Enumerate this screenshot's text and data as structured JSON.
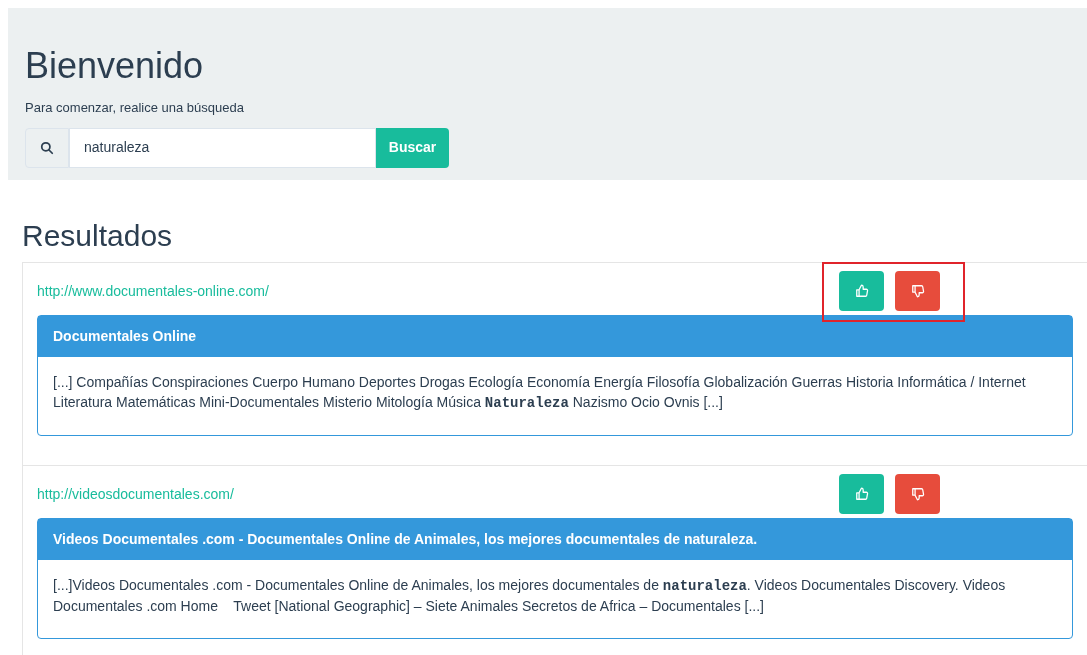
{
  "header": {
    "title": "Bienvenido",
    "subtitle": "Para comenzar, realice una búsqueda",
    "search": {
      "value": "naturaleza"
    },
    "search_button": "Buscar"
  },
  "results_title": "Resultados",
  "results": [
    {
      "url": "http://www.documentales-online.com/",
      "title": "Documentales Online",
      "snippet": "[...] Compañías Conspiraciones Cuerpo Humano Deportes Drogas Ecología Economía Energía Filosofía Globalización Guerras Historia Informática / Internet Literatura Matemáticas Mini-Documentales Misterio Mitología Música **Naturaleza** Nazismo Ocio Ovnis [...]",
      "highlighted": true
    },
    {
      "url": "http://videosdocumentales.com/",
      "title": "Videos Documentales .com - Documentales Online de Animales, los mejores documentales de naturaleza.",
      "snippet": "[...]Videos Documentales .com - Documentales Online de Animales, los mejores documentales de **naturaleza**. Videos Documentales Discovery. Videos Documentales .com Home    Tweet [National Geographic] – Siete Animales Secretos de Africa – Documentales [...]",
      "highlighted": false
    }
  ]
}
